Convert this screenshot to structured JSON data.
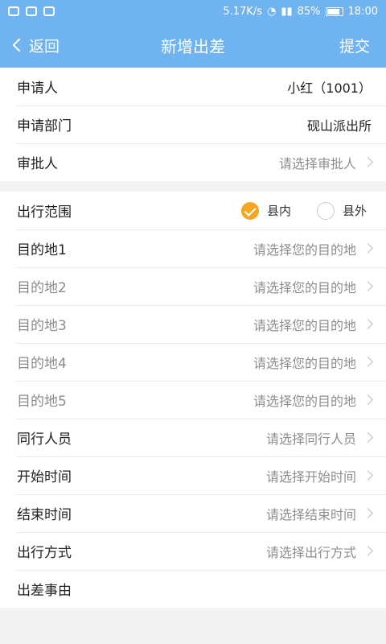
{
  "status": {
    "speed": "5.17K/s",
    "battery": "85%",
    "time": "18:00"
  },
  "nav": {
    "back": "返回",
    "title": "新增出差",
    "submit": "提交"
  },
  "applicant": {
    "label": "申请人",
    "value": "小红（1001）"
  },
  "department": {
    "label": "申请部门",
    "value": "砚山派出所"
  },
  "approver": {
    "label": "审批人",
    "placeholder": "请选择审批人"
  },
  "scope": {
    "label": "出行范围",
    "options": [
      "县内",
      "县外"
    ],
    "selected": "县内"
  },
  "destinations": [
    {
      "label": "目的地1",
      "placeholder": "请选择您的目的地"
    },
    {
      "label": "目的地2",
      "placeholder": "请选择您的目的地"
    },
    {
      "label": "目的地3",
      "placeholder": "请选择您的目的地"
    },
    {
      "label": "目的地4",
      "placeholder": "请选择您的目的地"
    },
    {
      "label": "目的地5",
      "placeholder": "请选择您的目的地"
    }
  ],
  "companions": {
    "label": "同行人员",
    "placeholder": "请选择同行人员"
  },
  "start_time": {
    "label": "开始时间",
    "placeholder": "请选择开始时间"
  },
  "end_time": {
    "label": "结束时间",
    "placeholder": "请选择结束时间"
  },
  "travel_mode": {
    "label": "出行方式",
    "placeholder": "请选择出行方式"
  },
  "reason": {
    "label": "出差事由"
  }
}
